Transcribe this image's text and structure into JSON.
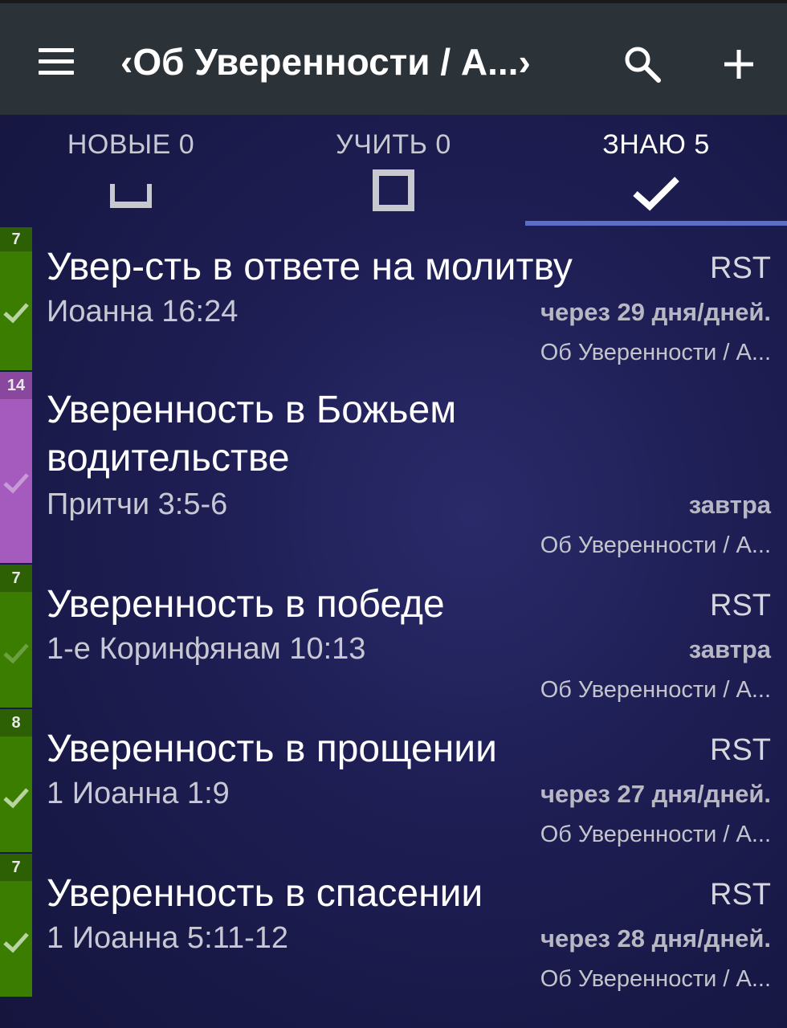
{
  "header": {
    "title": "‹Об Уверенности / А...›"
  },
  "tabs": [
    {
      "label": "НОВЫЕ 0",
      "icon": "space-icon"
    },
    {
      "label": "УЧИТЬ 0",
      "icon": "square-icon"
    },
    {
      "label": "ЗНАЮ 5",
      "icon": "check-icon",
      "active": true
    }
  ],
  "colors": {
    "green": "#3a7d00",
    "purple": "#a55bbd",
    "accent": "#5b6fc8"
  },
  "verses": [
    {
      "level": "7",
      "title": "Увер-сть в ответе на молитву",
      "reference": "Иоанна 16:24",
      "translation": "RST",
      "due": "через 29 дня/дней.",
      "collection": "Об Уверенности / А...",
      "color": "#3a7d00"
    },
    {
      "level": "14",
      "title": "Уверенность в Божьем водительстве",
      "reference": "Притчи 3:5-6",
      "translation": "",
      "due": "завтра",
      "collection": "Об Уверенности / А...",
      "color": "#a55bbd"
    },
    {
      "level": "7",
      "title": "Уверенность в победе",
      "reference": "1-е Коринфянам 10:13",
      "translation": "RST",
      "due": "завтра",
      "collection": "Об Уверенности / А...",
      "color": "#3a7d00"
    },
    {
      "level": "8",
      "title": "Уверенность в прощении",
      "reference": "1 Иоанна 1:9",
      "translation": "RST",
      "due": "через 27 дня/дней.",
      "collection": "Об Уверенности / А...",
      "color": "#3a7d00"
    },
    {
      "level": "7",
      "title": "Уверенность в спасении",
      "reference": "1 Иоанна 5:11-12",
      "translation": "RST",
      "due": "через 28 дня/дней.",
      "collection": "Об Уверенности / А...",
      "color": "#3a7d00"
    }
  ]
}
